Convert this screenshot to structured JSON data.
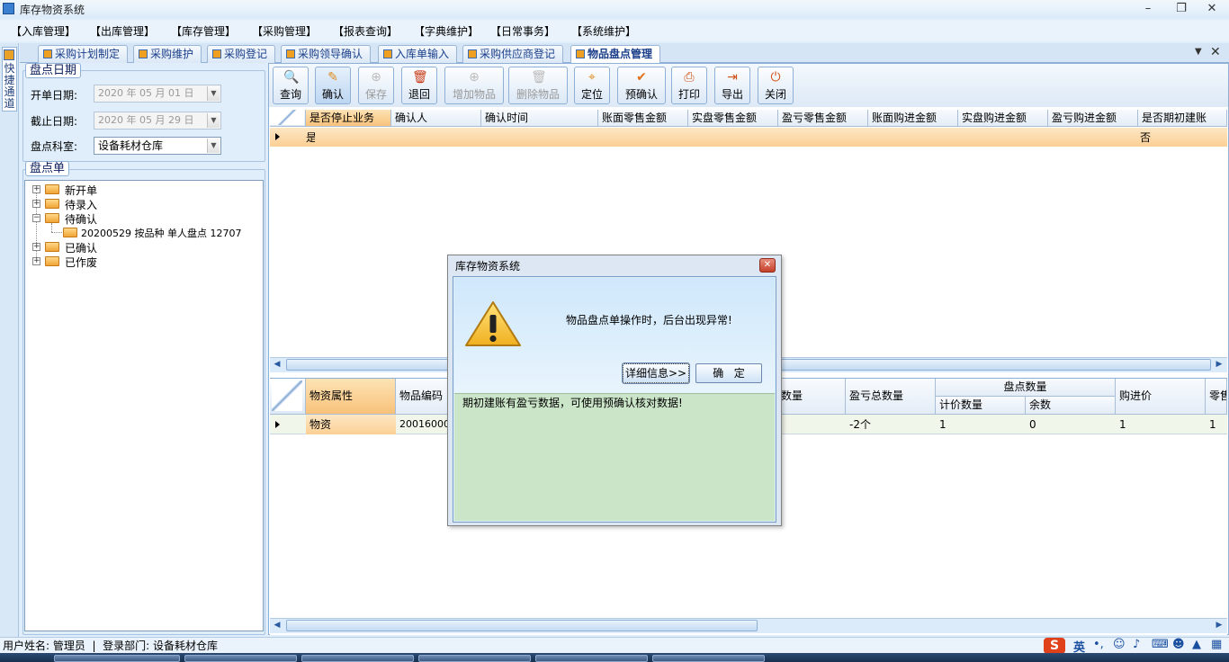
{
  "app": {
    "title": "库存物资系统",
    "minimize": "–",
    "restore": "❐",
    "close": "✕"
  },
  "menu": [
    "【入库管理】",
    "【出库管理】",
    "【库存管理】",
    "【采购管理】",
    "【报表查询】",
    "【字典维护】",
    "【日常事务】",
    "【系统维护】"
  ],
  "quick_channel": {
    "label": "快捷通道"
  },
  "tabs": [
    "采购计划制定",
    "采购维护",
    "采购登记",
    "采购领导确认",
    "入库单输入",
    "采购供应商登记",
    "物品盘点管理"
  ],
  "active_tab": "物品盘点管理",
  "left": {
    "date_group": "盘点日期",
    "start_label": "开单日期:",
    "start_value": "2020 年 05 月 01 日",
    "end_label": "截止日期:",
    "end_value": "2020 年 05 月 29 日",
    "dept_label": "盘点科室:",
    "dept_value": "设备耗材仓库",
    "list_group": "盘点单",
    "tree": {
      "new": "新开单",
      "pending_entry": "待录入",
      "pending_confirm": "待确认",
      "child": "20200529 按品种 单人盘点 12707",
      "confirmed": "已确认",
      "voided": "已作废"
    }
  },
  "toolbar": {
    "query": "查询",
    "confirm": "确认",
    "save": "保存",
    "return": "退回",
    "add_item": "增加物品",
    "delete_item": "删除物品",
    "locate": "定位",
    "pre_confirm": "预确认",
    "print": "打印",
    "export": "导出",
    "close": "关闭"
  },
  "top_grid": {
    "columns": [
      "是否停止业务",
      "确认人",
      "确认时间",
      "账面零售金额",
      "实盘零售金额",
      "盈亏零售金额",
      "账面购进金额",
      "实盘购进金额",
      "盈亏购进金额",
      "是否期初建账"
    ],
    "row": {
      "col0": "是",
      "last": "否"
    }
  },
  "bottom_grid": {
    "col_attr": "物资属性",
    "col_code": "物品编码",
    "col_qty_partial": "数量",
    "col_total": "盈亏总数量",
    "group_count": "盘点数量",
    "sub_count": "计价数量",
    "sub_rest": "余数",
    "col_price": "购进价",
    "col_retail_partial": "零售",
    "row": {
      "attr": "物资",
      "code": "200160000",
      "total": "-2个",
      "count": "1",
      "rest": "0",
      "price": "1",
      "retail": "1"
    }
  },
  "status": {
    "user": "用户姓名: 管理员  |  登录部门: 设备耗材仓库",
    "ime": "英"
  },
  "dialog": {
    "title": "库存物资系统",
    "message": "物品盘点单操作时，后台出现异常!",
    "details_button": "详细信息>>",
    "ok_button": "确   定",
    "detail_text": "期初建账有盈亏数据，可使用预确认核对数据!"
  }
}
